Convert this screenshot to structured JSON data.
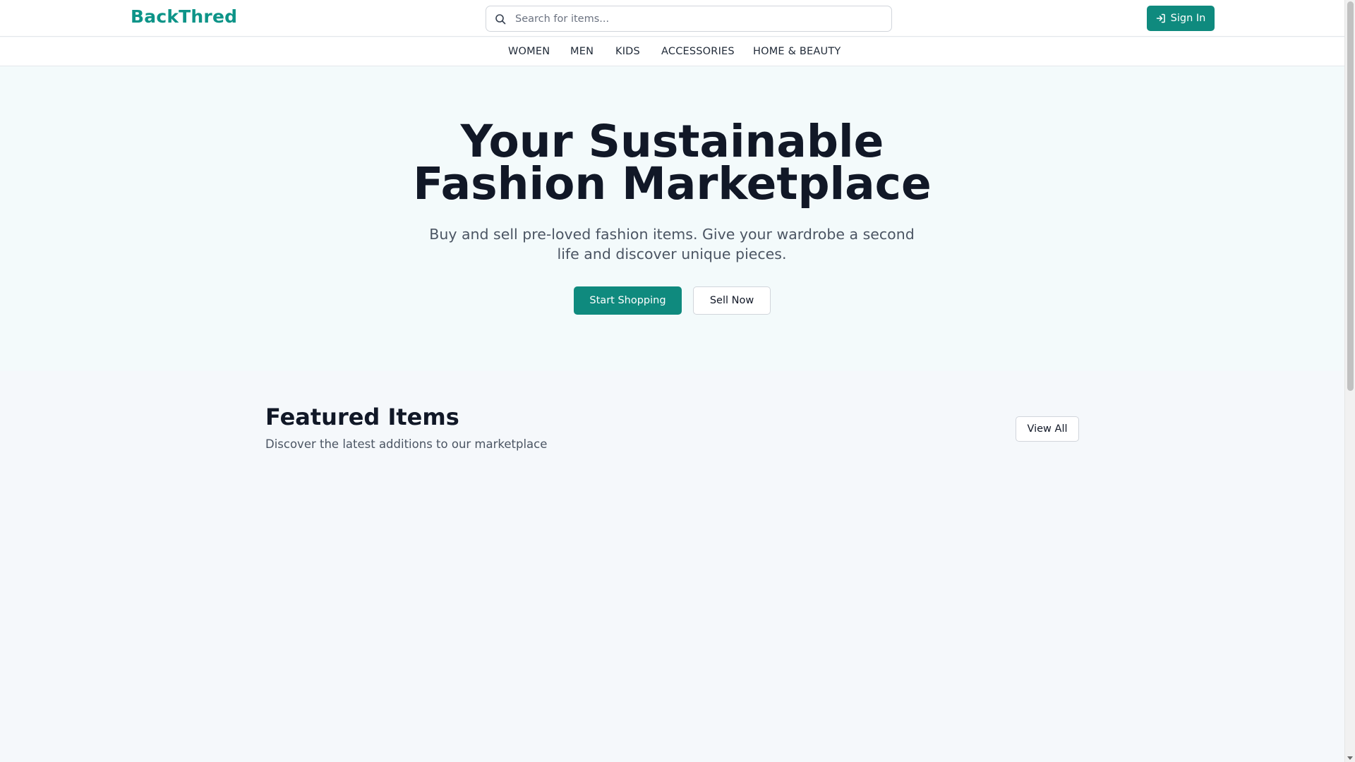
{
  "header": {
    "logo": "BackThred",
    "search_placeholder": "Search for items...",
    "signin_label": "Sign In",
    "brand_color": "#0d9488"
  },
  "nav": {
    "items": [
      "WOMEN",
      "MEN",
      "KIDS",
      "ACCESSORIES",
      "HOME & BEAUTY"
    ]
  },
  "hero": {
    "title_line1": "Your Sustainable",
    "title_line2": "Fashion Marketplace",
    "subtitle_line1": "Buy and sell pre-loved fashion items. Give your wardrobe a second",
    "subtitle_line2": "life and discover unique pieces.",
    "primary_button": "Start Shopping",
    "secondary_button": "Sell Now"
  },
  "featured": {
    "title": "Featured Items",
    "subtitle": "Discover the latest additions to our marketplace",
    "view_all": "View All"
  },
  "icons": {
    "search": "search-icon",
    "signin": "sign-in-icon"
  }
}
